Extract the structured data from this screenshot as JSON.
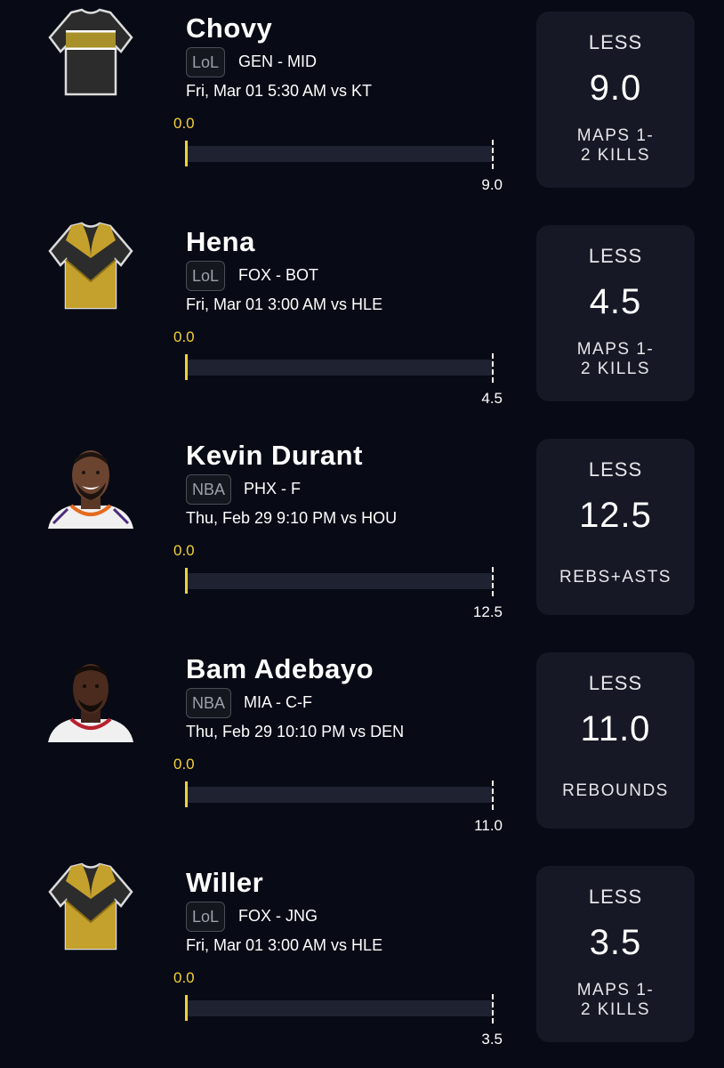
{
  "picks": [
    {
      "player": "Chovy",
      "avatar_icon": "jersey-black-gold-stripe-icon",
      "league": "LoL",
      "team_pos": "GEN - MID",
      "game_time": "Fri, Mar 01 5:30 AM  vs KT",
      "current": "0.0",
      "target": "9.0",
      "direction": "LESS",
      "line": "9.0",
      "stat": "MAPS 1-2 KILLS"
    },
    {
      "player": "Hena",
      "avatar_icon": "jersey-black-gold-chevron-icon",
      "league": "LoL",
      "team_pos": "FOX - BOT",
      "game_time": "Fri, Mar 01 3:00 AM  vs HLE",
      "current": "0.0",
      "target": "4.5",
      "direction": "LESS",
      "line": "4.5",
      "stat": "MAPS 1-2 KILLS"
    },
    {
      "player": "Kevin Durant",
      "avatar_icon": "player-headshot-icon",
      "league": "NBA",
      "team_pos": "PHX - F",
      "game_time": "Thu, Feb 29 9:10 PM  vs HOU",
      "current": "0.0",
      "target": "12.5",
      "direction": "LESS",
      "line": "12.5",
      "stat": "REBS+ASTS"
    },
    {
      "player": "Bam Adebayo",
      "avatar_icon": "player-headshot-icon",
      "league": "NBA",
      "team_pos": "MIA - C-F",
      "game_time": "Thu, Feb 29 10:10 PM  vs DEN",
      "current": "0.0",
      "target": "11.0",
      "direction": "LESS",
      "line": "11.0",
      "stat": "REBOUNDS"
    },
    {
      "player": "Willer",
      "avatar_icon": "jersey-black-gold-chevron-icon",
      "league": "LoL",
      "team_pos": "FOX - JNG",
      "game_time": "Fri, Mar 01 3:00 AM  vs HLE",
      "current": "0.0",
      "target": "3.5",
      "direction": "LESS",
      "line": "3.5",
      "stat": "MAPS 1-2 KILLS"
    }
  ],
  "colors": {
    "background": "#080a15",
    "card": "#161925",
    "progress_accent": "#f2d13b",
    "track": "#1f2230"
  }
}
